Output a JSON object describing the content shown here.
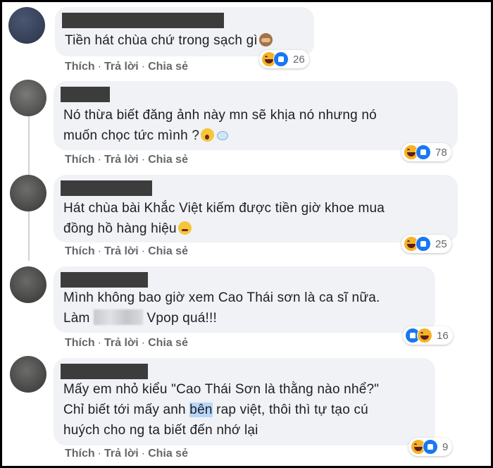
{
  "comments": [
    {
      "text_lines": [
        "Tiền hát chùa chứ trong sạch gì"
      ],
      "emoji": "see-no-evil-monkey",
      "reaction_count": "26",
      "reactions": [
        "haha",
        "like"
      ]
    },
    {
      "text_lines": [
        "Nó thừa biết đăng ảnh này mn sẽ khịa nó nhưng nó",
        "muốn chọc tức mình ?"
      ],
      "emoji": "astonished-face dash",
      "reaction_count": "78",
      "reactions": [
        "haha",
        "like"
      ]
    },
    {
      "text_lines": [
        "Hát chùa bài Khắc Việt kiếm được tiền giờ khoe mua",
        "đồng hồ hàng hiệu"
      ],
      "emoji": "flushed-face",
      "reaction_count": "25",
      "reactions": [
        "haha",
        "like"
      ]
    },
    {
      "text_lines": [
        "Mình không bao giờ xem Cao Thái sơn là ca sĩ nữa.",
        "Làm",
        "Vpop quá!!!"
      ],
      "emoji": "",
      "reaction_count": "16",
      "reactions": [
        "like",
        "haha"
      ]
    },
    {
      "text_lines": [
        "Mấy em nhỏ kiểu \"Cao Thái Sơn là thằng nào nhể?\"",
        "Chỉ biết tới mấy anh",
        "bên",
        "rap việt, thôi thì tự tạo cú",
        "huých cho ng ta biết đến nhớ lại"
      ],
      "emoji": "",
      "reaction_count": "9",
      "reactions": [
        "haha",
        "like"
      ]
    }
  ],
  "actions": {
    "like": "Thích",
    "reply": "Trả lời",
    "share": "Chia sẻ",
    "sep": "·"
  },
  "colors": {
    "bubble": "#f0f2f5",
    "action_text": "#65676b",
    "like_blue": "#1877f2",
    "haha_yellow": "#f7b125"
  }
}
